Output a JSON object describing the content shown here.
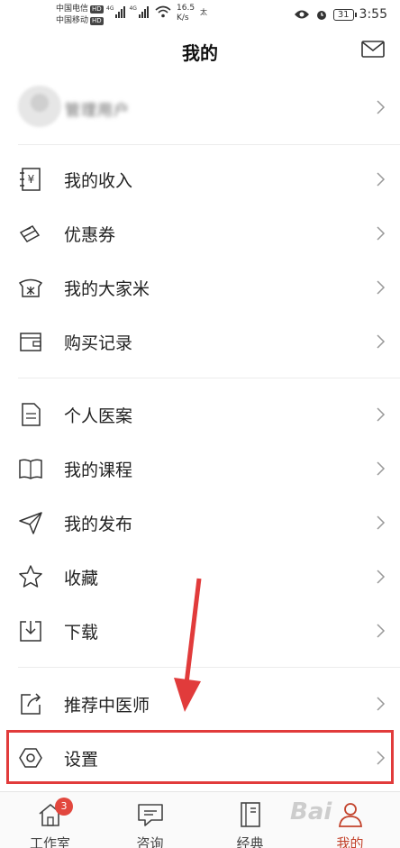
{
  "status_bar": {
    "carrier1": "中国电信",
    "carrier2": "中国移动",
    "hd": "HD",
    "net1": "4G",
    "net2": "4G",
    "speed_value": "16.5",
    "speed_unit": "K/s",
    "extra": "太",
    "battery": "31",
    "time": "3:55"
  },
  "header": {
    "title": "我的",
    "mail_icon": "mail-icon"
  },
  "profile": {
    "name": "管理用户"
  },
  "menu": {
    "income": "我的收入",
    "coupon": "优惠券",
    "rice": "我的大家米",
    "purchase": "购买记录",
    "case": "个人医案",
    "course": "我的课程",
    "publish": "我的发布",
    "favorite": "收藏",
    "download": "下载",
    "recommend": "推荐中医师",
    "settings": "设置"
  },
  "tabs": {
    "studio": "工作室",
    "studio_badge": "3",
    "consult": "咨询",
    "classic": "经典",
    "mine": "我的"
  },
  "colors": {
    "accent": "#c3432c",
    "highlight": "#e13b3b",
    "badge": "#e2473e"
  },
  "watermark": "Bai"
}
